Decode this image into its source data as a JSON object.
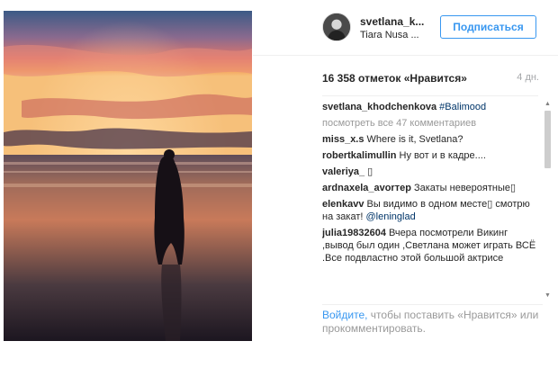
{
  "post": {
    "author": "svetlana_k...",
    "location": "Tiara Nusa ...",
    "follow_label": "Подписаться",
    "likes": "16 358 отметок «Нравится»",
    "time": "4 дн."
  },
  "comments": [
    {
      "author": "svetlana_khodchenkova",
      "text": "",
      "tag": "#Balimood"
    },
    {
      "author": "miss_x.s",
      "text": "Where is it, Svetlana?",
      "tag": ""
    },
    {
      "author": "robertkalimullin",
      "text": "Ну вот и в кадре....",
      "tag": ""
    },
    {
      "author": "valeriya_",
      "text": "▯",
      "tag": ""
    },
    {
      "author": "ardnaxela_avorтер",
      "text": "Закаты невероятные▯",
      "tag": ""
    },
    {
      "author": "elenkavv",
      "text": "Вы видимо в одном месте▯ смотрю на закат!",
      "tag": "@leninglad"
    },
    {
      "author": "julia19832604",
      "text": "Вчера посмотрели Викинг ,вывод был один ,Светлана может играть ВСЁ .Все подвластно этой большой актрисе",
      "tag": ""
    }
  ],
  "view_all": "посмотреть все 47 комментариев",
  "footer": {
    "login": "Войдите,",
    "rest": " чтобы поставить «Нравится» или прокомментировать."
  },
  "scrollbar": {
    "up_icon": "▲",
    "down_icon": "▼"
  },
  "colors": {
    "accent": "#3897f0",
    "text": "#262626",
    "muted": "#999999"
  }
}
